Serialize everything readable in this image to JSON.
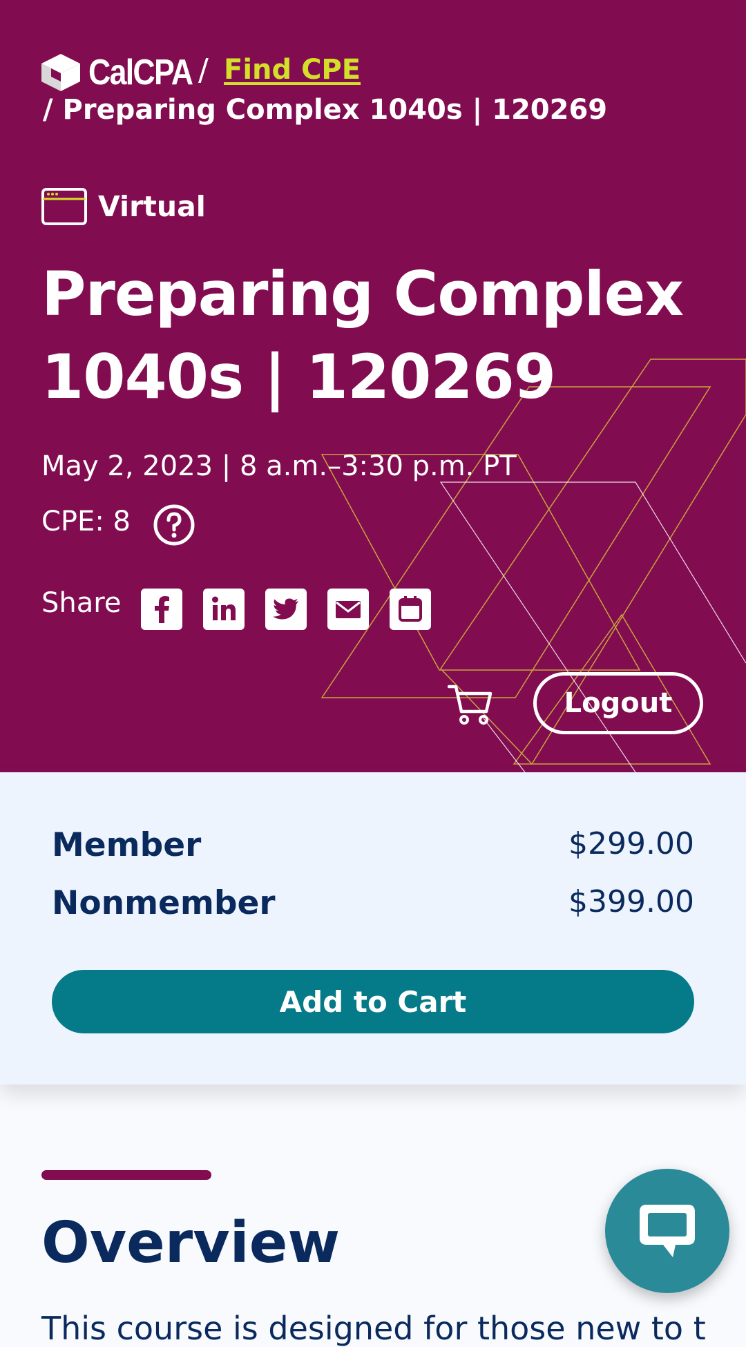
{
  "header": {
    "logo_text": "CalCPA",
    "crumb_sep": "/",
    "crumb_link": "Find CPE",
    "crumb_current": "/ Preparing Complex 1040s | 120269"
  },
  "event": {
    "format": "Virtual",
    "title": "Preparing Complex 1040s | 120269",
    "date": "May 2, 2023 | 8 a.m.–3:30 p.m. PT",
    "cpe": "CPE: 8",
    "share_label": "Share",
    "share_icons": [
      "facebook-icon",
      "linkedin-icon",
      "twitter-icon",
      "email-icon",
      "calendar-icon"
    ]
  },
  "actions": {
    "logout_label": "Logout"
  },
  "pricing": {
    "rows": [
      {
        "label": "Member",
        "price": "$299.00"
      },
      {
        "label": "Nonmember",
        "price": "$399.00"
      }
    ],
    "add_to_cart_label": "Add to Cart"
  },
  "overview": {
    "heading": "Overview",
    "body_start": "This course is designed for those new to t"
  },
  "colors": {
    "hero_bg": "#820c50",
    "accent_link": "#d4df2a",
    "navy": "#0a2a5e",
    "teal_button": "#057a88",
    "chat_button": "#2a8a98",
    "panel_bg": "#eef4fd"
  }
}
